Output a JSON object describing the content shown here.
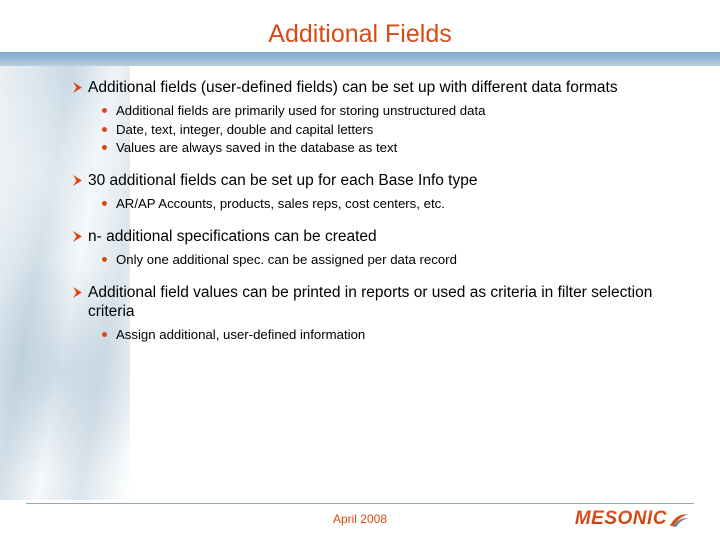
{
  "colors": {
    "accent": "#d84a16",
    "strip1": "#7fa8c9",
    "strip2": "#b8cee0"
  },
  "title": "Additional Fields",
  "sections": [
    {
      "text": "Additional fields (user-defined fields) can be set up with different data formats",
      "subs": [
        "Additional fields are primarily used for storing unstructured data",
        "Date, text, integer, double and capital letters",
        "Values are always saved in the database as text"
      ]
    },
    {
      "text": "30 additional fields can be set up for each Base Info type",
      "subs": [
        "AR/AP Accounts, products, sales reps, cost centers, etc."
      ]
    },
    {
      "text": "n- additional specifications can be created",
      "subs": [
        "Only one additional spec. can be assigned per data record"
      ]
    },
    {
      "text": "Additional field values can be printed in reports or used as criteria in filter selection criteria",
      "subs": [
        "Assign additional, user-defined information"
      ]
    }
  ],
  "footer": {
    "date": "April 2008"
  },
  "logo": {
    "text": "MESONIC"
  }
}
